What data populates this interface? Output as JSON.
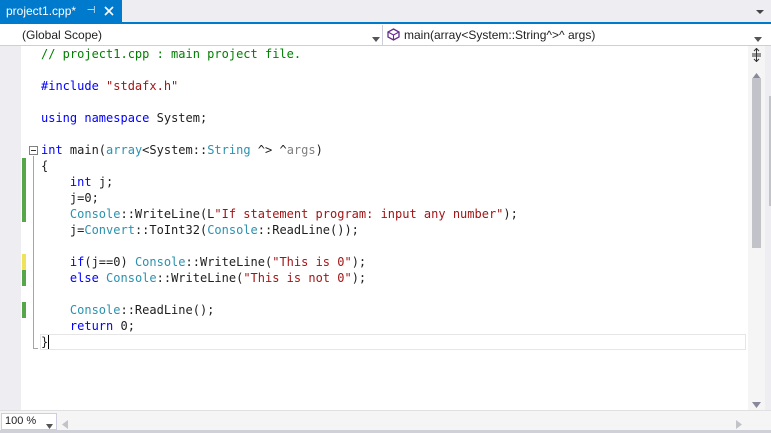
{
  "tab": {
    "title": "project1.cpp*",
    "pin_glyph": "⊣"
  },
  "navbar": {
    "scope": "(Global Scope)",
    "member": "main(array<System::String^>^ args)"
  },
  "code": {
    "lines": [
      [
        {
          "t": "// project1.cpp : main project file.",
          "c": "cm"
        }
      ],
      [],
      [
        {
          "t": "#include ",
          "c": "kw"
        },
        {
          "t": "\"stdafx.h\"",
          "c": "str"
        }
      ],
      [],
      [
        {
          "t": "using",
          "c": "kw"
        },
        {
          "t": " ",
          "c": "pl"
        },
        {
          "t": "namespace",
          "c": "kw"
        },
        {
          "t": " System;",
          "c": "pl"
        }
      ],
      [],
      [
        {
          "t": "int",
          "c": "kw"
        },
        {
          "t": " main(",
          "c": "pl"
        },
        {
          "t": "array",
          "c": "ty"
        },
        {
          "t": "<System::",
          "c": "pl"
        },
        {
          "t": "String",
          "c": "ty"
        },
        {
          "t": " ^> ^",
          "c": "pl"
        },
        {
          "t": "args",
          "c": "par"
        },
        {
          "t": ")",
          "c": "pl"
        }
      ],
      [
        {
          "t": "{",
          "c": "pl"
        }
      ],
      [
        {
          "t": "    ",
          "c": "pl"
        },
        {
          "t": "int",
          "c": "kw"
        },
        {
          "t": " j;",
          "c": "pl"
        }
      ],
      [
        {
          "t": "    j=0;",
          "c": "pl"
        }
      ],
      [
        {
          "t": "    ",
          "c": "pl"
        },
        {
          "t": "Console",
          "c": "ty"
        },
        {
          "t": "::WriteLine(L",
          "c": "pl"
        },
        {
          "t": "\"If statement program: input any number\"",
          "c": "str"
        },
        {
          "t": ");",
          "c": "pl"
        }
      ],
      [
        {
          "t": "    j=",
          "c": "pl"
        },
        {
          "t": "Convert",
          "c": "ty"
        },
        {
          "t": "::ToInt32(",
          "c": "pl"
        },
        {
          "t": "Console",
          "c": "ty"
        },
        {
          "t": "::ReadLine());",
          "c": "pl"
        }
      ],
      [],
      [
        {
          "t": "    ",
          "c": "pl"
        },
        {
          "t": "if",
          "c": "kw"
        },
        {
          "t": "(j==0) ",
          "c": "pl"
        },
        {
          "t": "Console",
          "c": "ty"
        },
        {
          "t": "::WriteLine(",
          "c": "pl"
        },
        {
          "t": "\"This is 0\"",
          "c": "str"
        },
        {
          "t": ");",
          "c": "pl"
        }
      ],
      [
        {
          "t": "    ",
          "c": "pl"
        },
        {
          "t": "else",
          "c": "kw"
        },
        {
          "t": " ",
          "c": "pl"
        },
        {
          "t": "Console",
          "c": "ty"
        },
        {
          "t": "::WriteLine(",
          "c": "pl"
        },
        {
          "t": "\"This is not 0\"",
          "c": "str"
        },
        {
          "t": ");",
          "c": "pl"
        }
      ],
      [],
      [
        {
          "t": "    ",
          "c": "pl"
        },
        {
          "t": "Console",
          "c": "ty"
        },
        {
          "t": "::ReadLine();",
          "c": "pl"
        }
      ],
      [
        {
          "t": "    ",
          "c": "pl"
        },
        {
          "t": "return",
          "c": "kw"
        },
        {
          "t": " 0;",
          "c": "pl"
        }
      ],
      [
        {
          "t": "}",
          "c": "pl"
        }
      ]
    ]
  },
  "status": {
    "zoom": "100 %"
  },
  "colors": {
    "accent": "#007ACC",
    "keyword": "#0000FF",
    "string": "#A31515",
    "comment": "#008000",
    "type": "#2B91AF",
    "saved_change": "#57A64A",
    "unsaved_change": "#EFE35B"
  },
  "icons": {
    "tab_pin": "pin-icon",
    "tab_close": "close-icon",
    "member_icon": "method-icon",
    "dropdown": "chevron-down-icon"
  }
}
